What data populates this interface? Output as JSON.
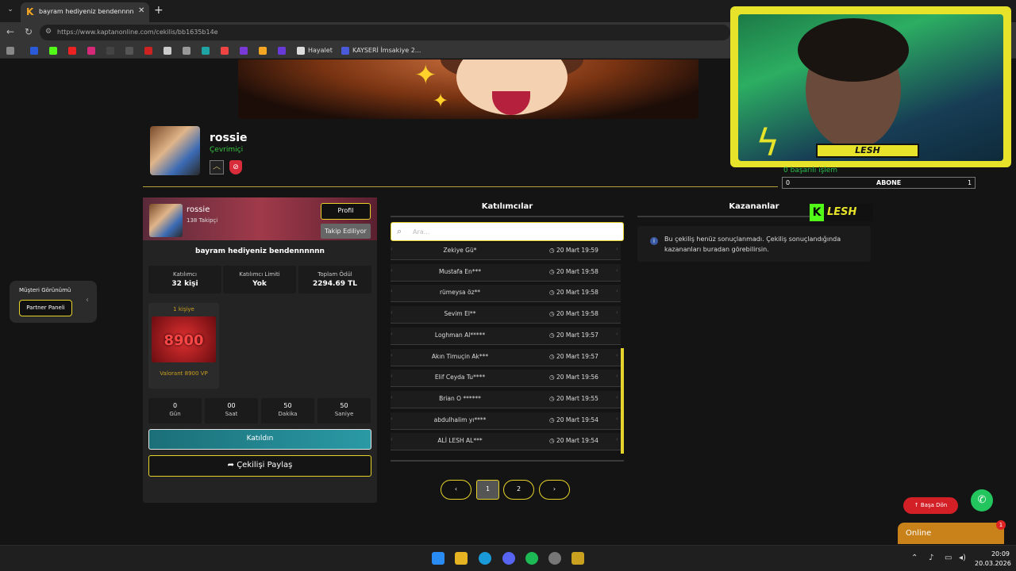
{
  "browser": {
    "tab_title": "bayram hediyeniz bendennnnnn - K",
    "url": "https://www.kaptanonline.com/cekilis/bb1635b14e",
    "bookmarks": [
      {
        "label": "Hayalet"
      },
      {
        "label": "KAYSERİ İmsakiye 2..."
      }
    ]
  },
  "profile": {
    "name": "rossie",
    "status": "Çevrimiçi"
  },
  "card": {
    "name": "rossie",
    "followers": "138 Takipçi",
    "profile_button": "Profil",
    "follow_button": "Takip Ediliyor",
    "giveaway_title": "bayram hediyeniz bendennnnnn",
    "stats": [
      {
        "label": "Katılımcı",
        "value": "32 kişi"
      },
      {
        "label": "Katılımcı Limiti",
        "value": "Yok"
      },
      {
        "label": "Toplam Ödül",
        "value": "2294.69 TL"
      }
    ],
    "prize": {
      "count": "1 kişiye",
      "image_text": "8900",
      "name": "Valorant 8900 VP"
    },
    "countdown": [
      {
        "value": "0",
        "unit": "Gün"
      },
      {
        "value": "00",
        "unit": "Saat"
      },
      {
        "value": "50",
        "unit": "Dakika"
      },
      {
        "value": "50",
        "unit": "Saniye"
      }
    ],
    "join_button": "Katıldın",
    "share_button": "Çekilişi Paylaş"
  },
  "participants": {
    "title": "Katılımcılar",
    "search_placeholder": "Ara...",
    "rows": [
      {
        "name": "Zekiye Gü*",
        "time": "20 Mart 19:59"
      },
      {
        "name": "Mustafa En***",
        "time": "20 Mart 19:58"
      },
      {
        "name": "rümeysa öz**",
        "time": "20 Mart 19:58"
      },
      {
        "name": "Sevim El**",
        "time": "20 Mart 19:58"
      },
      {
        "name": "Loghman Al*****",
        "time": "20 Mart 19:57"
      },
      {
        "name": "Akın Timuçin Ak***",
        "time": "20 Mart 19:57"
      },
      {
        "name": "Elif Ceyda Tu****",
        "time": "20 Mart 19:56"
      },
      {
        "name": "Brian O ******",
        "time": "20 Mart 19:55"
      },
      {
        "name": "abdulhalim yı****",
        "time": "20 Mart 19:54"
      },
      {
        "name": "ALİ LESH AL***",
        "time": "20 Mart 19:54"
      }
    ],
    "pagination": {
      "prev": "‹",
      "pages": [
        "1",
        "2"
      ],
      "current": "1",
      "next": "›"
    }
  },
  "winners": {
    "title": "Kazananlar",
    "info": "Bu çekiliş henüz sonuçlanmadı. Çekiliş sonuçlandığında kazananları buradan görebilirsin."
  },
  "side_panel": {
    "title": "Müşteri Görünümü",
    "button": "Partner Paneli"
  },
  "stream": {
    "name": "LESH",
    "success_text": "0 başarılı işlem",
    "sub_left": "0",
    "sub_label": "ABONE",
    "sub_right": "1",
    "kick_logo": "LESH"
  },
  "widgets": {
    "back_to_top": "Başa Dön",
    "online": "Online",
    "online_badge": "1"
  },
  "taskbar": {
    "time": "20:09",
    "date": "20.03.2026"
  },
  "colors": {
    "accent": "#e6d32a",
    "online": "#38c742",
    "join": "#2a9aa5",
    "danger": "#d31f26"
  }
}
